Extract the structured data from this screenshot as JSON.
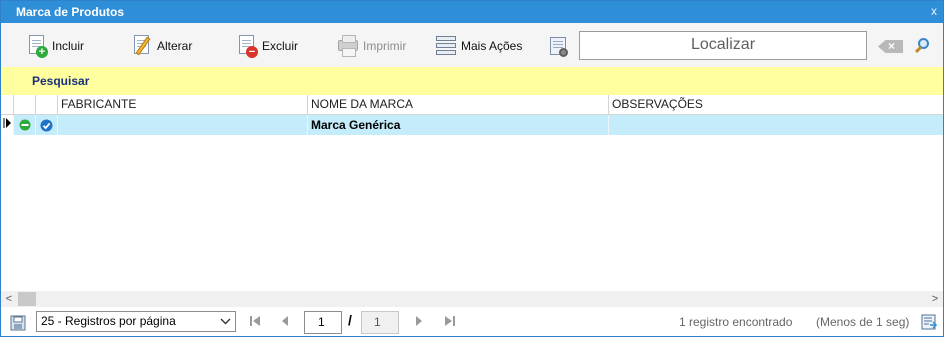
{
  "window": {
    "title": "Marca de Produtos",
    "close_label": "x"
  },
  "toolbar": {
    "incluir_label": "Incluir",
    "alterar_label": "Alterar",
    "excluir_label": "Excluir",
    "imprimir_label": "Imprimir",
    "mais_acoes_label": "Mais Ações",
    "search_placeholder": "Localizar"
  },
  "filter": {
    "pesquisar_label": "Pesquisar"
  },
  "grid": {
    "columns": [
      "FABRICANTE",
      "NOME DA MARCA",
      "OBSERVAÇÕES"
    ],
    "rows": [
      {
        "fabricante": "",
        "nome_da_marca": "Marca Genérica",
        "observacoes": "",
        "status": "active",
        "checked": true
      }
    ]
  },
  "pager": {
    "page_size_label": "25 - Registros por página",
    "current_page": "1",
    "separator": "/",
    "total_pages": "1",
    "records_found": "1 registro encontrado",
    "elapsed": "(Menos de 1 seg)"
  },
  "colors": {
    "titlebar": "#2f8ed8",
    "filterbar": "#ffff9f",
    "selected_row": "#c4ecfa",
    "status_green": "#2eaa3c",
    "check_blue": "#1f73c8"
  },
  "icons": [
    "add-document-icon",
    "edit-document-icon",
    "delete-document-icon",
    "printer-icon",
    "more-actions-icon",
    "grid-settings-icon",
    "clear-search-icon",
    "search-icon",
    "first-page-icon",
    "previous-page-icon",
    "next-page-icon",
    "last-page-icon",
    "save-layout-icon",
    "export-icon"
  ]
}
